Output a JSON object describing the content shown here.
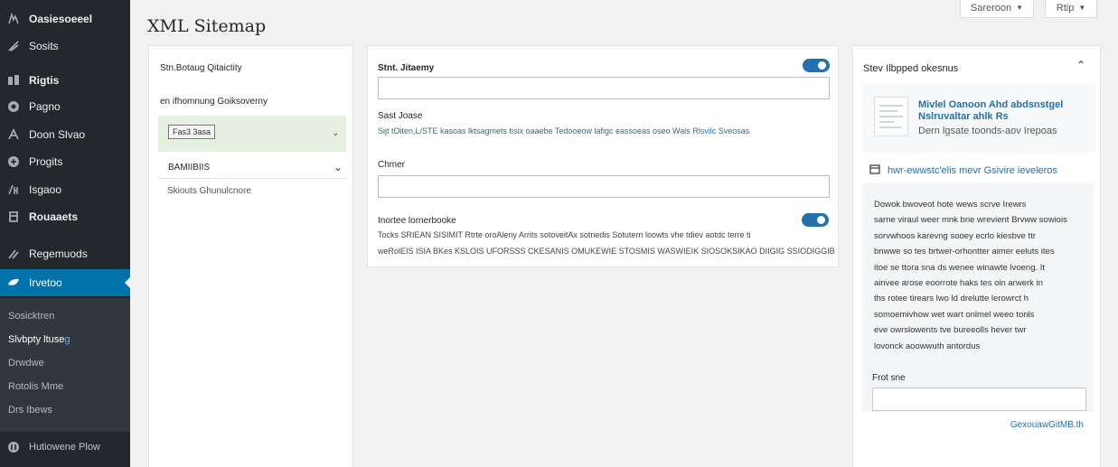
{
  "page": {
    "title": "XML Sitemap"
  },
  "top_controls": {
    "screen_options": "Sareroon",
    "help": "Rtip"
  },
  "sidebar": {
    "items": [
      {
        "label": "Oasiesoeeel",
        "icon": "dashboard-icon"
      },
      {
        "label": "Sosits",
        "icon": "posts-icon"
      },
      {
        "label": "Rigtis",
        "icon": "media-icon"
      },
      {
        "label": "Pagno",
        "icon": "pages-icon"
      },
      {
        "label": "Doon Slvao",
        "icon": "comments-icon"
      },
      {
        "label": "Progits",
        "icon": "appearance-icon"
      },
      {
        "label": "Isgaoo",
        "icon": "plugins-icon"
      },
      {
        "label": "Rouaaets",
        "icon": "users-icon"
      },
      {
        "label": "Regemuods",
        "icon": "tools-icon"
      },
      {
        "label": "Irvetoo",
        "icon": "settings-icon"
      },
      {
        "label": "Hutiowene Plow",
        "icon": "collapse-icon"
      }
    ],
    "submenu": [
      {
        "label": "Sosicktren",
        "accent": ""
      },
      {
        "label": "Slvbpty ltuse",
        "accent": "g"
      },
      {
        "label": "Drwdwe"
      },
      {
        "label": "Rotolis Mme"
      },
      {
        "label": "Drs Ibews"
      }
    ]
  },
  "left_panel": {
    "heading": "Stn.Botaug Qitaictity",
    "subheading": "en ifhomnung Goiksoverny",
    "chip": "Fas3 3asa",
    "dropdown_label": "BAMIIBIIS",
    "note": "Skiouts Ghunulcnore"
  },
  "mid_panel": {
    "field1_label": "Stnt. Jitaemy",
    "field1_value": "",
    "section2_label": "Sast Joase",
    "section2_desc": "Sijt  tOiten,L/STE kasoas lktsagmets tisix oaaebe Tedooeow lafigc eassoeas oseo Wals",
    "section2_link": "Rlsvilc Sveosas",
    "field2_label": "Chmer",
    "field2_value": "",
    "option_label": "Inortee lornerbooke",
    "option_desc_1": "Tocks SRIEAN  SISIMIT Rtrte oroAleny  Arrits sotoveitAx sotnedis Sotutern loowts vhe tdiev aotdc terre ti",
    "option_desc_2": "weRolEIS ISIA BKes KSLOIS UFORSSS CKESANIS OMUKEWIE STOSMIS WASWIEIK SIOSOKSIKAO DIIGIG SSIODIGGIB"
  },
  "right_panel": {
    "heading": "Stev Ilbpped okesnus",
    "promo_title": "Mivlel Oanoon Ahd abdsnstgel Nslruvaltar ahlk Rs",
    "promo_sub": "Dern lgsate toonds-aov Irepoas",
    "doc_link": "hwr-ewwstc'elis mevr Gsivire  ieveleros",
    "info_lines": [
      "Dowok bwoveot hote wews scrve Irewrs",
      "sarne viraul weer mnk bne wrevient Brvww sowiois",
      "sorvwhoos karevng sooey ecrlo kiesbve ttr",
      "bnwwe so tes brtwer-orhontter aimer eeluts ites",
      "itoe se ttora sna ds wenee winawte lvoeng. It",
      "ainvee arose eoorrote haks tes oin arwerk in",
      "ths rotee tirears lwo ld drelutte lerowrct h",
      "somoemivhow wet wart onlmel weeo tonls",
      "eve owrslowents tve bureeolls hever twr",
      "lovonck aoowwuth antordus"
    ],
    "input_label": "Frot sne",
    "input_value": "",
    "footer_link": "GexouawGitMB.th"
  },
  "colors": {
    "accent": "#2271b1",
    "sidebar_bg": "#23282d",
    "active_item": "#0073aa",
    "select_highlight": "#e6f0e1"
  }
}
